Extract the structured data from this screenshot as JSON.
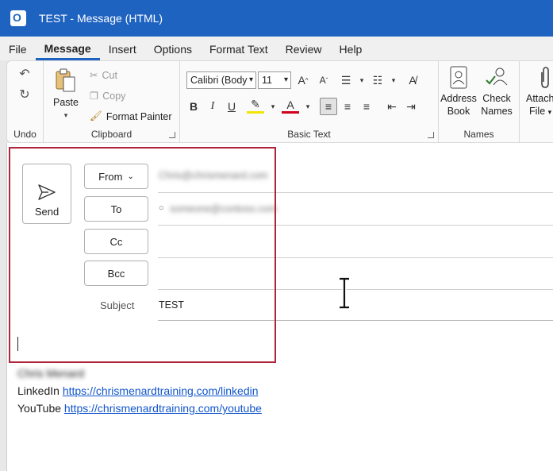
{
  "window": {
    "title": "TEST  -  Message (HTML)"
  },
  "menu": [
    "File",
    "Message",
    "Insert",
    "Options",
    "Format Text",
    "Review",
    "Help"
  ],
  "ribbon": {
    "undo": {
      "label": "Undo"
    },
    "clipboard": {
      "label": "Clipboard",
      "paste": "Paste",
      "cut": "Cut",
      "copy": "Copy",
      "format_painter": "Format Painter"
    },
    "basic_text": {
      "label": "Basic Text",
      "font": "Calibri (Body",
      "size": "11"
    },
    "names": {
      "label": "Names",
      "address_book_1": "Address",
      "address_book_2": "Book",
      "check_names_1": "Check",
      "check_names_2": "Names"
    },
    "attach": {
      "line1": "Attach",
      "line2": "File"
    }
  },
  "compose": {
    "send": "Send",
    "from": "From",
    "from_value": "Chris@chrismenard.com",
    "to": "To",
    "to_value": "someone@contoso.com",
    "cc": "Cc",
    "bcc": "Bcc",
    "subject_label": "Subject",
    "subject_value": "TEST"
  },
  "signature": {
    "name": "Chris Menard",
    "linkedin_label": "LinkedIn",
    "linkedin_url": "https://chrismenardtraining.com/linkedin",
    "youtube_label": "YouTube",
    "youtube_url": "https://chrismenardtraining.com/youtube"
  },
  "colors": {
    "titlebar": "#1f63c1",
    "highlight": "#b0243a",
    "link": "#1155cc"
  }
}
